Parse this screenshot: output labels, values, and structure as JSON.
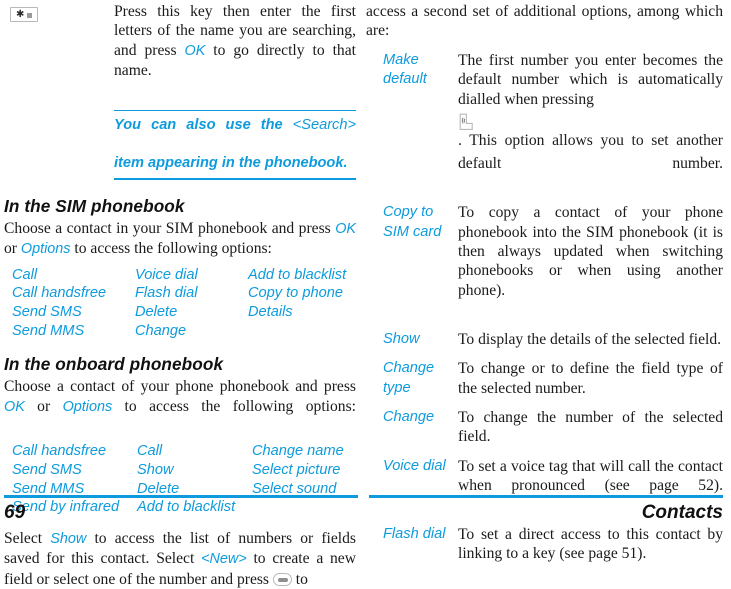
{
  "document": {
    "footer": {
      "page_number": "69",
      "running_head": "Contacts",
      "rule_color": "#0e9bdd"
    },
    "accent_color": "#0e9bdd",
    "text_color": "#1a1a1a"
  },
  "left_column": {
    "intro": {
      "key_icon": "star-key-icon",
      "text_before_ok": "Press this key then enter the first letters of the name you are searching, and press ",
      "ok_label": "OK",
      "text_after_ok": " to go directly to that name."
    },
    "note": {
      "line1_before": "You can also use the ",
      "line1_highlight": "<Search>",
      "line2": "item appearing in the phonebook."
    },
    "sim_section": {
      "heading": "In the SIM phonebook",
      "intro_part1": "Choose a contact in your SIM phonebook and press ",
      "intro_ok": "OK",
      "intro_mid": " or ",
      "intro_options": "Options",
      "intro_part2": " to access the following options:",
      "options": [
        "Call",
        "Voice dial",
        "Add to blacklist",
        "Call handsfree",
        "Flash dial",
        "Copy to phone",
        "Send SMS",
        "Delete",
        "Details",
        "Send MMS",
        "Change",
        ""
      ]
    },
    "onboard_section": {
      "heading": "In the onboard phonebook",
      "intro_part1": "Choose a contact of your phone phonebook and press ",
      "intro_ok": "OK",
      "intro_mid": " or ",
      "intro_options": "Options",
      "intro_part2": " to access the following options:",
      "options": [
        "Call handsfree",
        "Call",
        "Change name",
        "Send SMS",
        "Show",
        "Select picture",
        "Send MMS",
        "Delete",
        "Select sound",
        "Send by infrared",
        "Add to blacklist",
        ""
      ]
    },
    "closing": {
      "part1": "Select ",
      "show_label": "Show",
      "part2": " to access the list of numbers or fields saved for this contact. Select ",
      "new_label": "<New>",
      "part3": " to create a new field or select one of the number and press ",
      "ok_key_icon": "ok-key-icon",
      "part4": " to"
    }
  },
  "right_column": {
    "continuation": "access a second set of additional options, among which are:",
    "definitions": [
      {
        "term": "Make default",
        "desc_part1": "The first number you enter becomes the default number which is automatically dialled when pressing ",
        "call_key_icon": "call-key-icon",
        "desc_part2": ". This option allows you to set another default number."
      },
      {
        "term": "Copy to SIM card",
        "desc_part1": "To copy a contact of your phone phonebook into the SIM phonebook (it is then always updated when switching phonebooks or when using another phone).",
        "call_key_icon": "",
        "desc_part2": ""
      },
      {
        "term": "Show",
        "desc_part1": "To display the details of the selected field.",
        "call_key_icon": "",
        "desc_part2": ""
      },
      {
        "term": "Change type",
        "desc_part1": "To change or to define the field type of the selected number.",
        "call_key_icon": "",
        "desc_part2": ""
      },
      {
        "term": "Change",
        "desc_part1": "To change the number of the selected field.",
        "call_key_icon": "",
        "desc_part2": ""
      },
      {
        "term": "Voice dial",
        "desc_part1": "To set a voice tag that will call the contact when pronounced (see page 52).",
        "call_key_icon": "",
        "desc_part2": ""
      },
      {
        "term": "Flash dial",
        "desc_part1": "To set a direct access to this contact by linking to a key (see page 51).",
        "call_key_icon": "",
        "desc_part2": ""
      }
    ]
  }
}
